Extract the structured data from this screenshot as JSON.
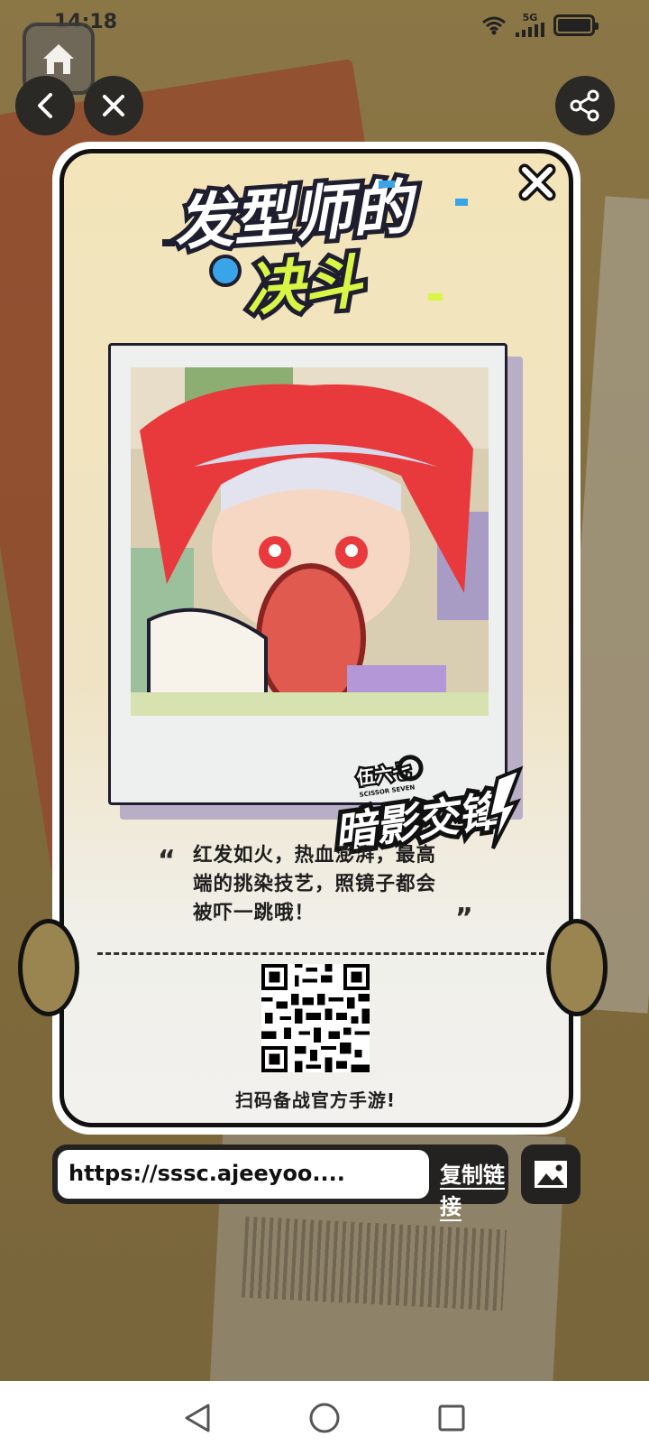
{
  "status_bar": {
    "time": "14:18",
    "network": "5G",
    "icons": [
      "wifi-icon",
      "signal-icon",
      "battery-icon"
    ]
  },
  "top_controls": {
    "home": "home-icon",
    "back": "back-arrow-icon",
    "close": "close-icon",
    "share": "share-icon"
  },
  "card": {
    "logo_line1": "发型师的",
    "logo_line2": "决斗",
    "brand_badge": "暗影交锋",
    "brand_sub": "SCISSOR SEVEN",
    "brand_top": "伍六七",
    "quote": "红发如火，热血澎湃，最高端的挑染技艺，照镜子都会被吓一跳哦！",
    "quote_open": "“",
    "quote_close": "”",
    "scan_text": "扫码备战官方手游!"
  },
  "link_bar": {
    "url": "https://sssc.ajeeyoo....",
    "copy_label": "复制链接",
    "image_button": "image-icon"
  },
  "nav_bar": {
    "items": [
      "back-triangle-icon",
      "home-circle-icon",
      "recents-square-icon"
    ]
  },
  "colors": {
    "card_border": "#111111",
    "logo_blue": "#3aa4e8",
    "logo_yellow": "#d9f545",
    "dark_button": "#232220",
    "hair_red": "#e8393c"
  }
}
